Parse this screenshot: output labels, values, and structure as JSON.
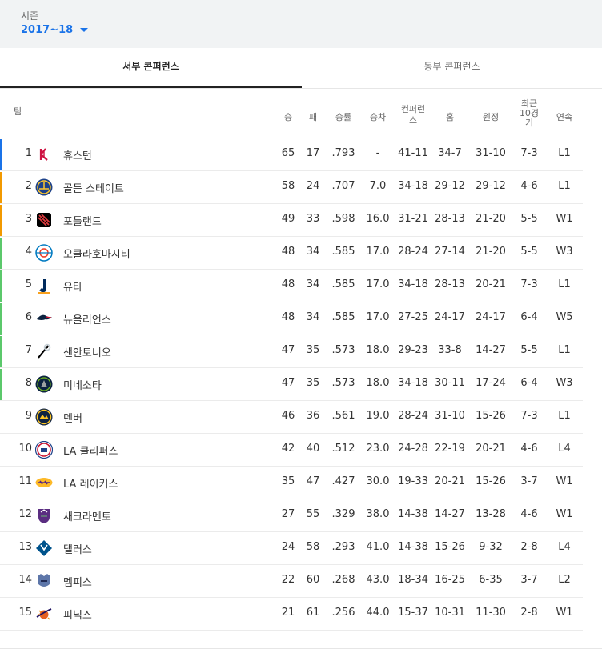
{
  "season": {
    "label": "시즌",
    "value": "2017~18"
  },
  "tabs": [
    {
      "label": "서부 콘퍼런스",
      "active": true
    },
    {
      "label": "동부 콘퍼런스",
      "active": false
    }
  ],
  "columns": {
    "team": "팀",
    "wins": "승",
    "losses": "패",
    "pct": "승률",
    "gb": "승차",
    "conf_lines": [
      "컨퍼런",
      "스"
    ],
    "home": "홈",
    "away": "원정",
    "last10_lines": [
      "최근",
      "10경",
      "기"
    ],
    "streak": "연속"
  },
  "colors": {
    "playoff_top": "#1a73e8",
    "playoff_mid": "#f29900",
    "playoff_low": "#5bc86b"
  },
  "rows": [
    {
      "rank": "1",
      "logo": "rockets-logo-icon",
      "name": "휴스턴",
      "w": "65",
      "l": "17",
      "pct": ".793",
      "gb": "-",
      "conf": "41-11",
      "home": "34-7",
      "away": "31-10",
      "last10": "7-3",
      "streak": "L1",
      "bar": "#1a73e8"
    },
    {
      "rank": "2",
      "logo": "warriors-logo-icon",
      "name": "골든 스테이트",
      "w": "58",
      "l": "24",
      "pct": ".707",
      "gb": "7.0",
      "conf": "34-18",
      "home": "29-12",
      "away": "29-12",
      "last10": "4-6",
      "streak": "L1",
      "bar": "#f29900"
    },
    {
      "rank": "3",
      "logo": "trailblazers-logo-icon",
      "name": "포틀랜드",
      "w": "49",
      "l": "33",
      "pct": ".598",
      "gb": "16.0",
      "conf": "31-21",
      "home": "28-13",
      "away": "21-20",
      "last10": "5-5",
      "streak": "W1",
      "bar": "#f29900"
    },
    {
      "rank": "4",
      "logo": "thunder-logo-icon",
      "name": "오클라호마시티",
      "w": "48",
      "l": "34",
      "pct": ".585",
      "gb": "17.0",
      "conf": "28-24",
      "home": "27-14",
      "away": "21-20",
      "last10": "5-5",
      "streak": "W3",
      "bar": "#5bc86b"
    },
    {
      "rank": "5",
      "logo": "jazz-logo-icon",
      "name": "유타",
      "w": "48",
      "l": "34",
      "pct": ".585",
      "gb": "17.0",
      "conf": "34-18",
      "home": "28-13",
      "away": "20-21",
      "last10": "7-3",
      "streak": "L1",
      "bar": "#5bc86b"
    },
    {
      "rank": "6",
      "logo": "pelicans-logo-icon",
      "name": "뉴올리언스",
      "w": "48",
      "l": "34",
      "pct": ".585",
      "gb": "17.0",
      "conf": "27-25",
      "home": "24-17",
      "away": "24-17",
      "last10": "6-4",
      "streak": "W5",
      "bar": "#5bc86b"
    },
    {
      "rank": "7",
      "logo": "spurs-logo-icon",
      "name": "샌안토니오",
      "w": "47",
      "l": "35",
      "pct": ".573",
      "gb": "18.0",
      "conf": "29-23",
      "home": "33-8",
      "away": "14-27",
      "last10": "5-5",
      "streak": "L1",
      "bar": "#5bc86b"
    },
    {
      "rank": "8",
      "logo": "timberwolves-logo-icon",
      "name": "미네소타",
      "w": "47",
      "l": "35",
      "pct": ".573",
      "gb": "18.0",
      "conf": "34-18",
      "home": "30-11",
      "away": "17-24",
      "last10": "6-4",
      "streak": "W3",
      "bar": "#5bc86b"
    },
    {
      "rank": "9",
      "logo": "nuggets-logo-icon",
      "name": "덴버",
      "w": "46",
      "l": "36",
      "pct": ".561",
      "gb": "19.0",
      "conf": "28-24",
      "home": "31-10",
      "away": "15-26",
      "last10": "7-3",
      "streak": "L1",
      "bar": ""
    },
    {
      "rank": "10",
      "logo": "clippers-logo-icon",
      "name": "LA 클리퍼스",
      "w": "42",
      "l": "40",
      "pct": ".512",
      "gb": "23.0",
      "conf": "24-28",
      "home": "22-19",
      "away": "20-21",
      "last10": "4-6",
      "streak": "L4",
      "bar": ""
    },
    {
      "rank": "11",
      "logo": "lakers-logo-icon",
      "name": "LA 레이커스",
      "w": "35",
      "l": "47",
      "pct": ".427",
      "gb": "30.0",
      "conf": "19-33",
      "home": "20-21",
      "away": "15-26",
      "last10": "3-7",
      "streak": "W1",
      "bar": ""
    },
    {
      "rank": "12",
      "logo": "kings-logo-icon",
      "name": "새크라멘토",
      "w": "27",
      "l": "55",
      "pct": ".329",
      "gb": "38.0",
      "conf": "14-38",
      "home": "14-27",
      "away": "13-28",
      "last10": "4-6",
      "streak": "W1",
      "bar": ""
    },
    {
      "rank": "13",
      "logo": "mavericks-logo-icon",
      "name": "댈러스",
      "w": "24",
      "l": "58",
      "pct": ".293",
      "gb": "41.0",
      "conf": "14-38",
      "home": "15-26",
      "away": "9-32",
      "last10": "2-8",
      "streak": "L4",
      "bar": ""
    },
    {
      "rank": "14",
      "logo": "grizzlies-logo-icon",
      "name": "멤피스",
      "w": "22",
      "l": "60",
      "pct": ".268",
      "gb": "43.0",
      "conf": "18-34",
      "home": "16-25",
      "away": "6-35",
      "last10": "3-7",
      "streak": "L2",
      "bar": ""
    },
    {
      "rank": "15",
      "logo": "suns-logo-icon",
      "name": "피닉스",
      "w": "21",
      "l": "61",
      "pct": ".256",
      "gb": "44.0",
      "conf": "15-37",
      "home": "10-31",
      "away": "11-30",
      "last10": "2-8",
      "streak": "W1",
      "bar": ""
    }
  ]
}
